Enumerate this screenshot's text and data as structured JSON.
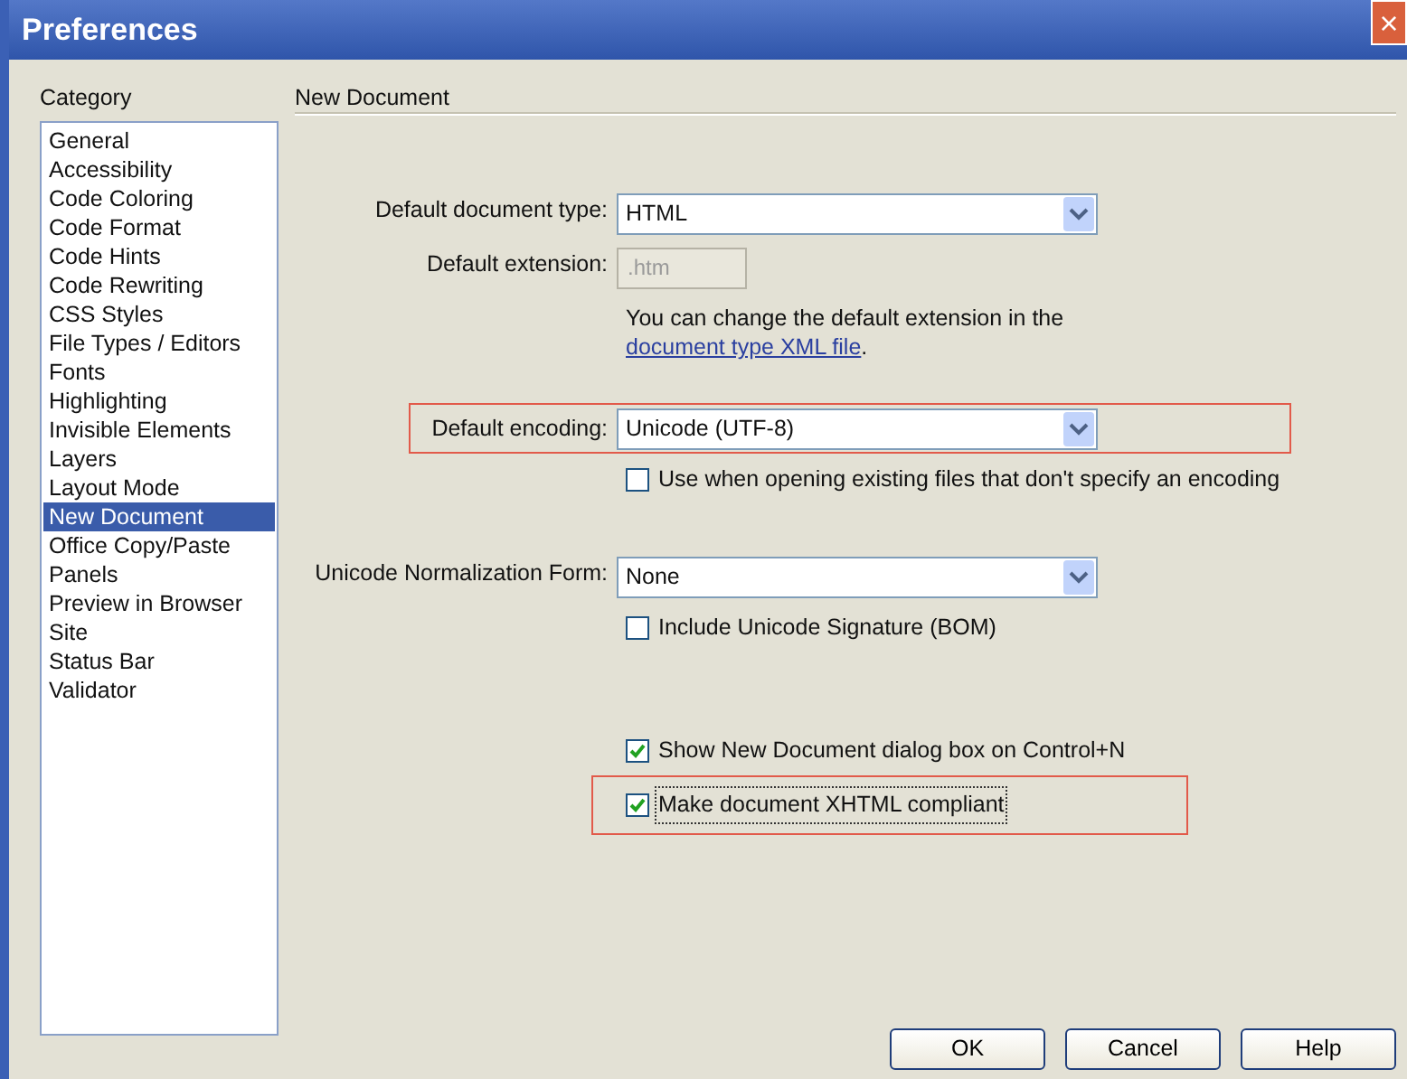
{
  "window": {
    "title": "Preferences",
    "close": "×"
  },
  "category": {
    "label": "Category",
    "items": [
      {
        "label": "General",
        "selected": false
      },
      {
        "label": "Accessibility",
        "selected": false
      },
      {
        "label": "Code Coloring",
        "selected": false
      },
      {
        "label": "Code Format",
        "selected": false
      },
      {
        "label": "Code Hints",
        "selected": false
      },
      {
        "label": "Code Rewriting",
        "selected": false
      },
      {
        "label": "CSS Styles",
        "selected": false
      },
      {
        "label": "File Types / Editors",
        "selected": false
      },
      {
        "label": "Fonts",
        "selected": false
      },
      {
        "label": "Highlighting",
        "selected": false
      },
      {
        "label": "Invisible Elements",
        "selected": false
      },
      {
        "label": "Layers",
        "selected": false
      },
      {
        "label": "Layout Mode",
        "selected": false
      },
      {
        "label": "New Document",
        "selected": true
      },
      {
        "label": "Office Copy/Paste",
        "selected": false
      },
      {
        "label": "Panels",
        "selected": false
      },
      {
        "label": "Preview in Browser",
        "selected": false
      },
      {
        "label": "Site",
        "selected": false
      },
      {
        "label": "Status Bar",
        "selected": false
      },
      {
        "label": "Validator",
        "selected": false
      }
    ]
  },
  "panel": {
    "title": "New Document",
    "groups": [
      {
        "items": [
          {
            "kind": "select",
            "label": "Default document type:",
            "value": "HTML",
            "highlighted": false
          },
          {
            "kind": "text",
            "label": "Default extension:",
            "value": ".htm",
            "disabled": true,
            "highlighted": false
          },
          {
            "kind": "note",
            "text": "You can change the default extension in the",
            "link": "document type XML file",
            "after": "."
          }
        ]
      },
      {
        "items": [
          {
            "kind": "select",
            "label": "Default encoding:",
            "value": "Unicode (UTF-8)",
            "highlighted": true
          },
          {
            "kind": "checkbox",
            "label": "Use when opening existing files that don't specify an encoding",
            "checked": false,
            "focused": false,
            "highlighted": false
          }
        ]
      },
      {
        "items": [
          {
            "kind": "select",
            "label": "Unicode Normalization Form:",
            "value": "None",
            "highlighted": false
          },
          {
            "kind": "checkbox",
            "label": "Include Unicode Signature (BOM)",
            "checked": false,
            "focused": false,
            "highlighted": false
          }
        ]
      },
      {
        "items": [
          {
            "kind": "checkbox",
            "label": "Show New Document dialog box on Control+N",
            "checked": true,
            "focused": false,
            "highlighted": false
          },
          {
            "kind": "checkbox",
            "label": "Make document XHTML compliant",
            "checked": true,
            "focused": true,
            "highlighted": true
          }
        ]
      }
    ]
  },
  "buttons": [
    "OK",
    "Cancel",
    "Help"
  ]
}
